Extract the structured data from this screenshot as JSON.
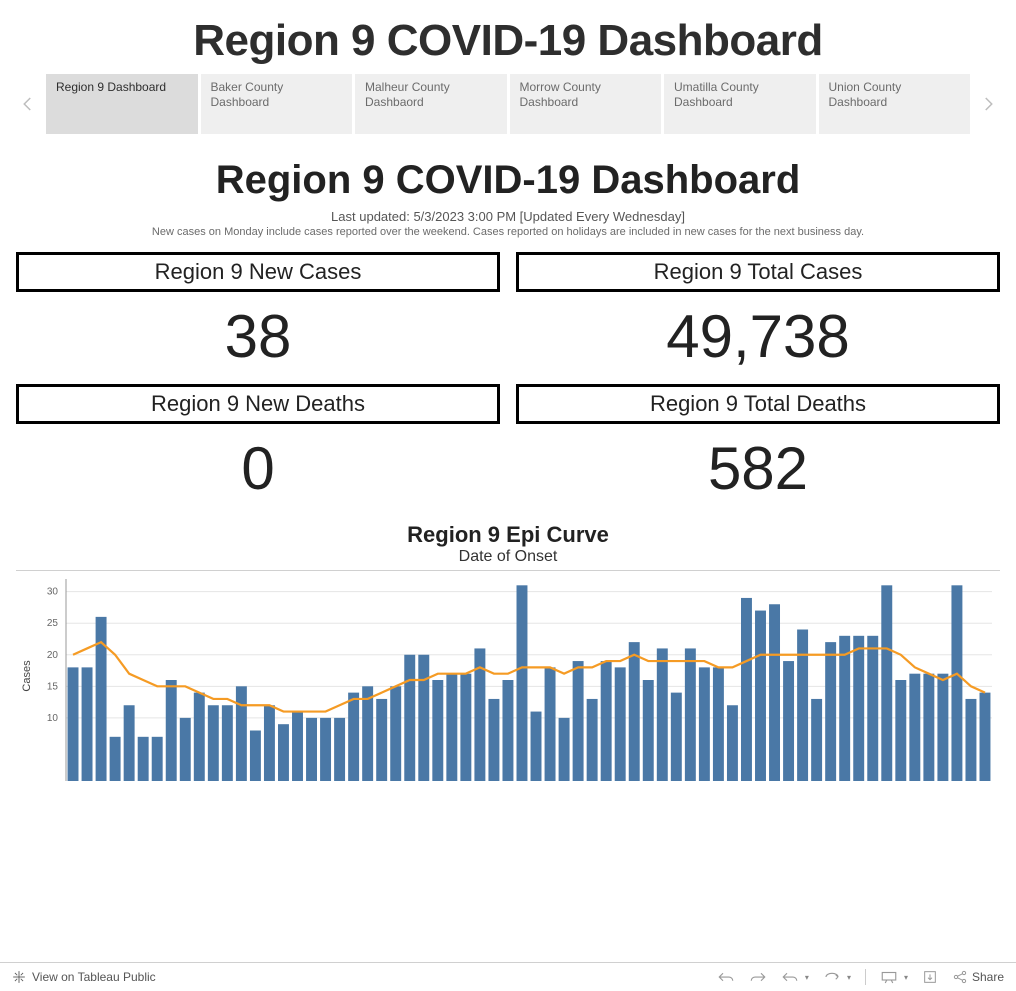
{
  "page_title": "Region 9 COVID-19 Dashboard",
  "tabs": [
    {
      "label": "Region 9 Dashboard",
      "active": true
    },
    {
      "label": "Baker County Dashboard",
      "active": false
    },
    {
      "label": "Malheur County Dashbaord",
      "active": false
    },
    {
      "label": "Morrow County Dashboard",
      "active": false
    },
    {
      "label": "Umatilla County Dashboard",
      "active": false
    },
    {
      "label": "Union County Dashboard",
      "active": false
    }
  ],
  "inner_title": "Region 9 COVID-19 Dashboard",
  "subtitle": "Last updated: 5/3/2023 3:00 PM [Updated Every Wednesday]",
  "subnote": "New cases on Monday include cases reported over the weekend. Cases reported on holidays are included in new cases for the next business day.",
  "metrics": {
    "new_cases": {
      "label": "Region 9 New Cases",
      "value": "38"
    },
    "total_cases": {
      "label": "Region 9 Total Cases",
      "value": "49,738"
    },
    "new_deaths": {
      "label": "Region 9 New Deaths",
      "value": "0"
    },
    "total_deaths": {
      "label": "Region 9 Total Deaths",
      "value": "582"
    }
  },
  "footer": {
    "view_on": "View on Tableau Public",
    "share": "Share"
  },
  "chart_data": {
    "type": "bar",
    "title": "Region 9 Epi Curve",
    "subtitle": "Date of Onset",
    "ylabel": "Cases",
    "ylim": [
      0,
      32
    ],
    "yticks": [
      10,
      15,
      20,
      25,
      30
    ],
    "series": [
      {
        "name": "Cases (bars)",
        "kind": "bar",
        "color": "#4a78a6",
        "values": [
          18,
          18,
          26,
          7,
          12,
          7,
          7,
          16,
          10,
          14,
          12,
          12,
          15,
          8,
          12,
          9,
          11,
          10,
          10,
          10,
          14,
          15,
          13,
          15,
          20,
          20,
          16,
          17,
          17,
          21,
          13,
          16,
          31,
          11,
          18,
          10,
          19,
          13,
          19,
          18,
          22,
          16,
          21,
          14,
          21,
          18,
          18,
          12,
          29,
          27,
          28,
          19,
          24,
          13,
          22,
          23,
          23,
          23,
          31,
          16,
          17,
          17,
          17,
          31,
          13,
          14
        ]
      },
      {
        "name": "7-day avg (line)",
        "kind": "line",
        "color": "#f59b24",
        "values": [
          20,
          21,
          22,
          20,
          17,
          16,
          15,
          15,
          15,
          14,
          13,
          13,
          12,
          12,
          12,
          11,
          11,
          11,
          11,
          12,
          13,
          13,
          14,
          15,
          16,
          16,
          17,
          17,
          17,
          18,
          17,
          17,
          18,
          18,
          18,
          17,
          18,
          18,
          19,
          19,
          20,
          19,
          19,
          19,
          19,
          19,
          18,
          18,
          19,
          20,
          20,
          20,
          20,
          20,
          20,
          20,
          21,
          21,
          21,
          20,
          18,
          17,
          16,
          17,
          15,
          14
        ]
      }
    ]
  }
}
